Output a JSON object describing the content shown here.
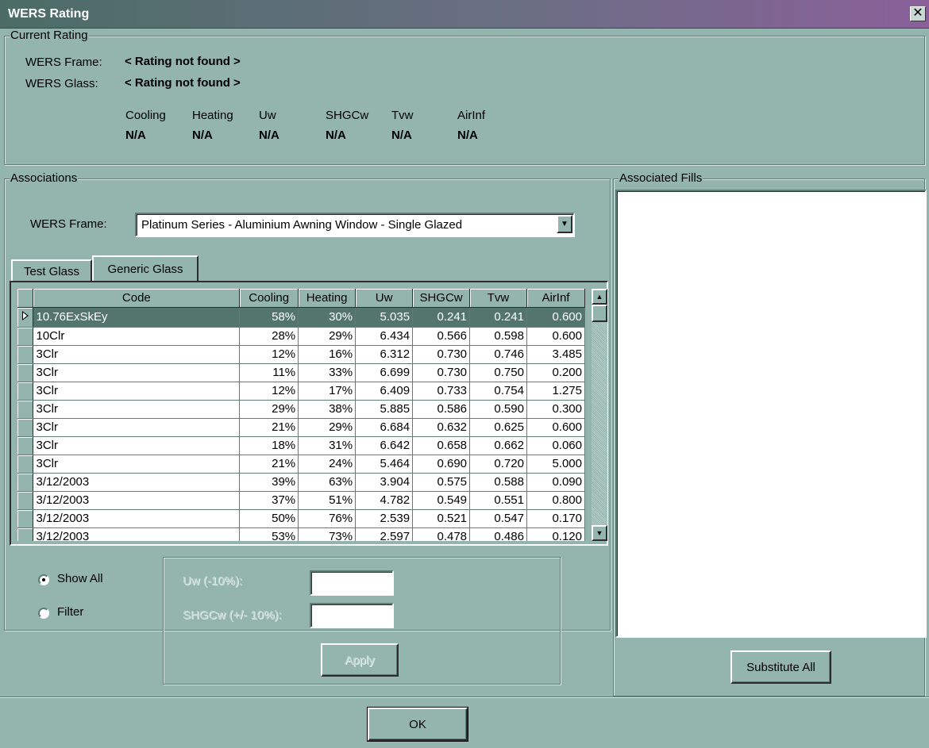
{
  "window": {
    "title": "WERS Rating",
    "close_glyph": "✕"
  },
  "current_rating": {
    "group_title": "Current Rating",
    "frame_label": "WERS Frame:",
    "frame_value": "< Rating not found >",
    "glass_label": "WERS Glass:",
    "glass_value": "< Rating not found >",
    "metrics": [
      {
        "label": "Cooling",
        "value": "N/A"
      },
      {
        "label": "Heating",
        "value": "N/A"
      },
      {
        "label": "Uw",
        "value": "N/A"
      },
      {
        "label": "SHGCw",
        "value": "N/A"
      },
      {
        "label": "Tvw",
        "value": "N/A"
      },
      {
        "label": "AirInf",
        "value": "N/A"
      }
    ]
  },
  "associations": {
    "group_title": "Associations",
    "frame_label": "WERS Frame:",
    "frame_selected": "Platinum Series - Aluminium Awning Window - Single Glazed",
    "tabs": [
      {
        "label": "Test Glass",
        "active": false
      },
      {
        "label": "Generic Glass",
        "active": true
      }
    ],
    "grid": {
      "columns": [
        "Code",
        "Cooling",
        "Heating",
        "Uw",
        "SHGCw",
        "Tvw",
        "AirInf"
      ],
      "rows": [
        [
          "10.76ExSkEy",
          "58%",
          "30%",
          "5.035",
          "0.241",
          "0.241",
          "0.600"
        ],
        [
          "10Clr",
          "28%",
          "29%",
          "6.434",
          "0.566",
          "0.598",
          "0.600"
        ],
        [
          "3Clr",
          "12%",
          "16%",
          "6.312",
          "0.730",
          "0.746",
          "3.485"
        ],
        [
          "3Clr",
          "11%",
          "33%",
          "6.699",
          "0.730",
          "0.750",
          "0.200"
        ],
        [
          "3Clr",
          "12%",
          "17%",
          "6.409",
          "0.733",
          "0.754",
          "1.275"
        ],
        [
          "3Clr",
          "29%",
          "38%",
          "5.885",
          "0.586",
          "0.590",
          "0.300"
        ],
        [
          "3Clr",
          "21%",
          "29%",
          "6.684",
          "0.632",
          "0.625",
          "0.600"
        ],
        [
          "3Clr",
          "18%",
          "31%",
          "6.642",
          "0.658",
          "0.662",
          "0.060"
        ],
        [
          "3Clr",
          "21%",
          "24%",
          "5.464",
          "0.690",
          "0.720",
          "5.000"
        ],
        [
          "3/12/2003",
          "39%",
          "63%",
          "3.904",
          "0.575",
          "0.588",
          "0.090"
        ],
        [
          "3/12/2003",
          "37%",
          "51%",
          "4.782",
          "0.549",
          "0.551",
          "0.800"
        ],
        [
          "3/12/2003",
          "50%",
          "76%",
          "2.539",
          "0.521",
          "0.547",
          "0.170"
        ],
        [
          "3/12/2003",
          "53%",
          "73%",
          "2.597",
          "0.478",
          "0.486",
          "0.120"
        ]
      ],
      "selected_row": 0
    },
    "filter": {
      "show_all_label": "Show All",
      "filter_label": "Filter",
      "selected": "show_all",
      "uw_label": "Uw (-10%):",
      "uw_value": "",
      "shgc_label": "SHGCw (+/- 10%):",
      "shgc_value": "",
      "apply_label": "Apply"
    }
  },
  "associated_fills": {
    "group_title": "Associated Fills",
    "substitute_label": "Substitute All"
  },
  "footer": {
    "ok_label": "OK"
  }
}
